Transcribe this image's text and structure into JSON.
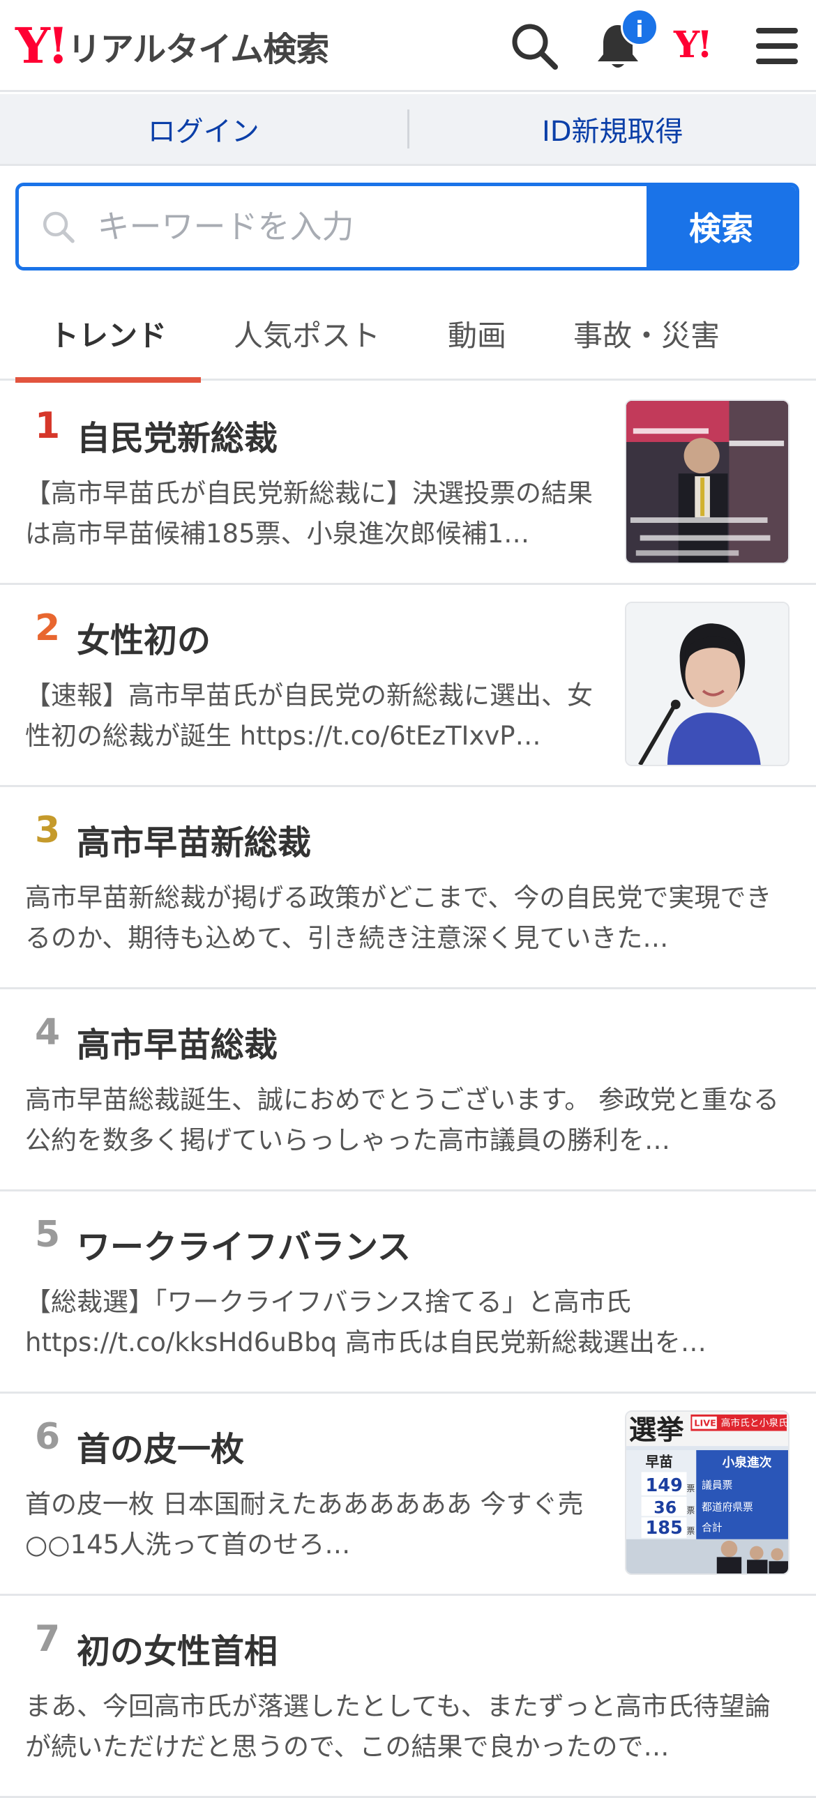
{
  "header": {
    "logo_mark": "Y!",
    "logo_text": "リアルタイム検索",
    "notification_badge": "i",
    "yahoo_mark": "Y!"
  },
  "login": {
    "login_label": "ログイン",
    "signup_label": "ID新規取得"
  },
  "search": {
    "placeholder": "キーワードを入力",
    "button_label": "検索"
  },
  "tabs": [
    {
      "label": "トレンド",
      "active": true
    },
    {
      "label": "人気ポスト",
      "active": false
    },
    {
      "label": "動画",
      "active": false
    },
    {
      "label": "事故・災害",
      "active": false
    }
  ],
  "colors": {
    "accent": "#1a73e8",
    "brand_red": "#ff0033",
    "tab_underline": "#e2543e",
    "rank1": "#d6372a",
    "rank2": "#e8662f",
    "rank3": "#c59a2b",
    "rank_other": "#9a9a9a"
  },
  "trends": [
    {
      "rank": "1",
      "title": "自民党新総裁",
      "desc": "【高市早苗氏が自民党新総裁に】決選投票の結果は高市早苗候補185票、小泉進次郎候補1…",
      "has_thumb": true
    },
    {
      "rank": "2",
      "title": "女性初の",
      "desc": "【速報】高市早苗氏が自民党の新総裁に選出、女性初の総裁が誕生 https://t.co/6tEzTIxvP…",
      "has_thumb": true
    },
    {
      "rank": "3",
      "title": "高市早苗新総裁",
      "desc": "高市早苗新総裁が掲げる政策がどこまで、今の自民党で実現できるのか、期待も込めて、引き続き注意深く見ていきた…",
      "has_thumb": false
    },
    {
      "rank": "4",
      "title": "高市早苗総裁",
      "desc": "高市早苗総裁誕生、誠におめでとうございます。 参政党と重なる公約を数多く掲げていらっしゃった高市議員の勝利を…",
      "has_thumb": false
    },
    {
      "rank": "5",
      "title": "ワークライフバランス",
      "desc": "【総裁選】「ワークライフバランス捨てる」と高市氏 https://t.co/kksHd6uBbq 高市氏は自民党新総裁選出を…",
      "has_thumb": false
    },
    {
      "rank": "6",
      "title": "首の皮一枚",
      "desc": "首の皮一枚 日本国耐えたああああああ 今すぐ売○○145人洗って首のせろ…",
      "has_thumb": true
    },
    {
      "rank": "7",
      "title": "初の女性首相",
      "desc": "まあ、今回高市氏が落選したとしても、またずっと高市氏待望論が続いただけだと思うので、この結果で良かったので…",
      "has_thumb": false
    }
  ],
  "thumb6": {
    "banner": "選挙",
    "live": "LIVE",
    "live_caption": "高市氏と小泉氏",
    "left_name": "早苗",
    "right_name": "小泉進次",
    "row_labels": [
      "議員票",
      "都道府県票",
      "合計"
    ],
    "votes": [
      "149",
      "36",
      "185"
    ],
    "unit": "票"
  }
}
